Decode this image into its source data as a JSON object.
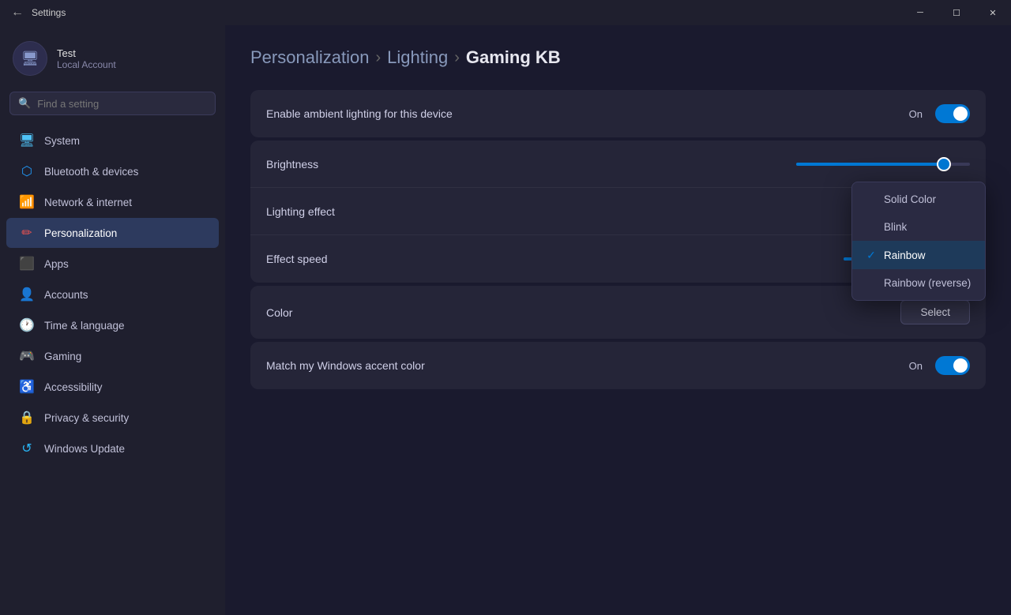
{
  "titlebar": {
    "title": "Settings"
  },
  "sidebar": {
    "user": {
      "name": "Test",
      "type": "Local Account",
      "avatar_icon": "🖥"
    },
    "search": {
      "placeholder": "Find a setting"
    },
    "nav_items": [
      {
        "id": "system",
        "label": "System",
        "icon": "🖥",
        "icon_class": "icon-system"
      },
      {
        "id": "bluetooth",
        "label": "Bluetooth & devices",
        "icon": "⬡",
        "icon_class": "icon-bluetooth"
      },
      {
        "id": "network",
        "label": "Network & internet",
        "icon": "📶",
        "icon_class": "icon-network"
      },
      {
        "id": "personalization",
        "label": "Personalization",
        "icon": "✏",
        "icon_class": "icon-personalization",
        "active": true
      },
      {
        "id": "apps",
        "label": "Apps",
        "icon": "⬛",
        "icon_class": "icon-apps"
      },
      {
        "id": "accounts",
        "label": "Accounts",
        "icon": "👤",
        "icon_class": "icon-accounts"
      },
      {
        "id": "time",
        "label": "Time & language",
        "icon": "🕐",
        "icon_class": "icon-time"
      },
      {
        "id": "gaming",
        "label": "Gaming",
        "icon": "🎮",
        "icon_class": "icon-gaming"
      },
      {
        "id": "accessibility",
        "label": "Accessibility",
        "icon": "♿",
        "icon_class": "icon-accessibility"
      },
      {
        "id": "privacy",
        "label": "Privacy & security",
        "icon": "🔒",
        "icon_class": "icon-privacy"
      },
      {
        "id": "update",
        "label": "Windows Update",
        "icon": "↺",
        "icon_class": "icon-update"
      }
    ]
  },
  "content": {
    "breadcrumbs": [
      {
        "label": "Personalization",
        "active": false
      },
      {
        "label": "Lighting",
        "active": false
      },
      {
        "label": "Gaming KB",
        "active": true
      }
    ],
    "ambient_label": "Enable ambient lighting for this device",
    "ambient_state": "On",
    "brightness_label": "Brightness",
    "brightness_percent": 85,
    "lighting_effect_label": "Lighting effect",
    "lighting_effect_value": "Rainbow",
    "effect_speed_label": "Effect speed",
    "effect_speed_percent": 40,
    "color_label": "Color",
    "color_button": "Select",
    "accent_label": "Match my Windows accent color",
    "accent_state": "On",
    "dropdown_options": [
      {
        "label": "Solid Color",
        "selected": false
      },
      {
        "label": "Blink",
        "selected": false
      },
      {
        "label": "Rainbow",
        "selected": true
      },
      {
        "label": "Rainbow (reverse)",
        "selected": false
      }
    ]
  }
}
